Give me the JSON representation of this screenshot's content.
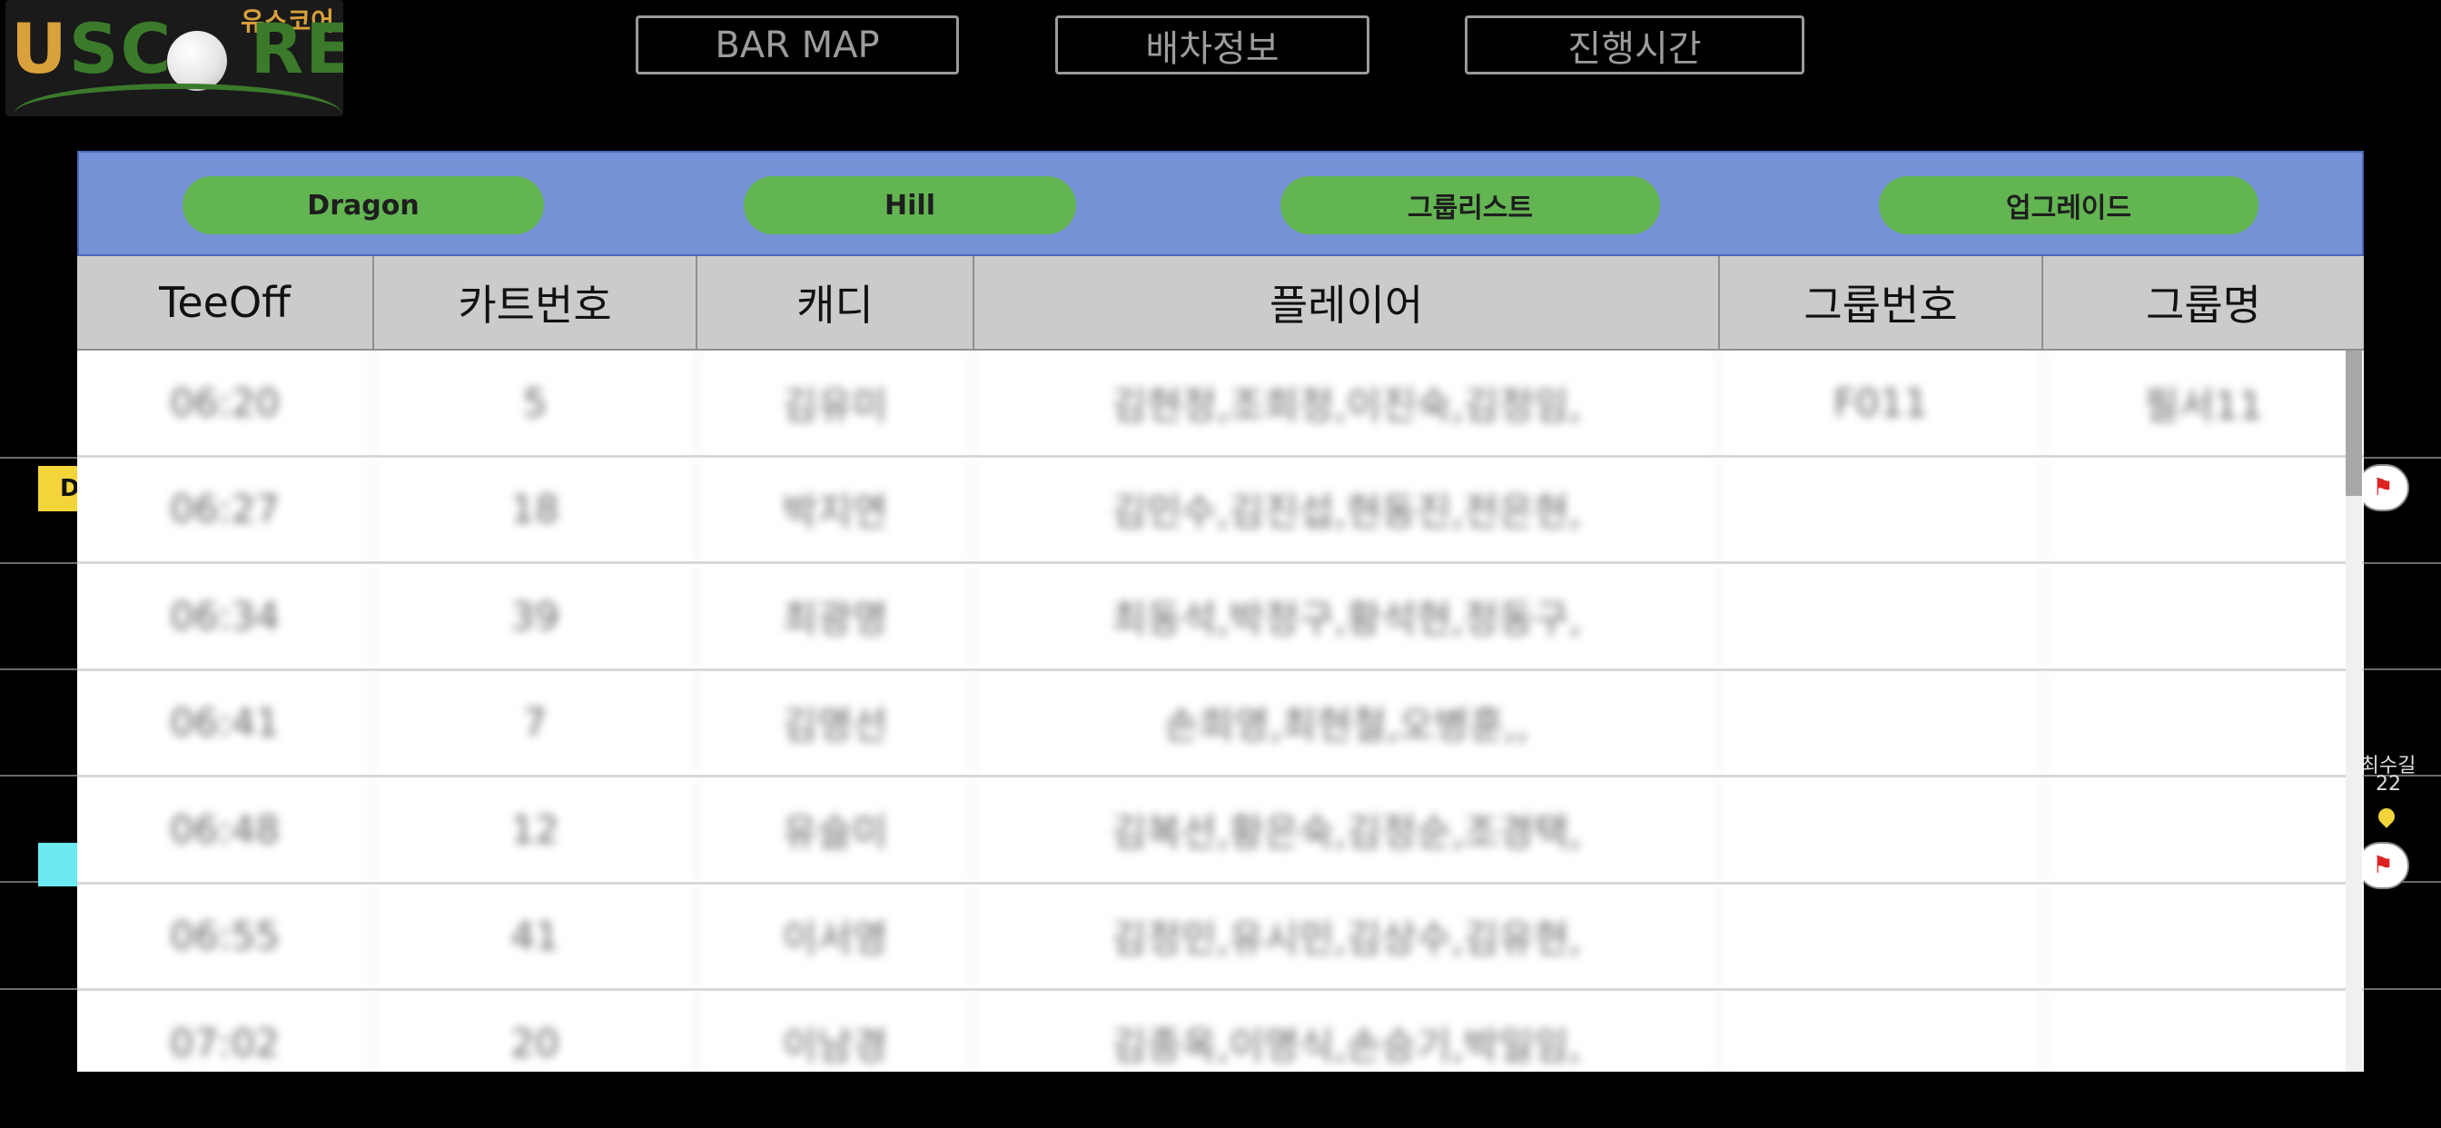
{
  "logo": {
    "small_text": "유스코어",
    "big_text": "USCORE"
  },
  "top_buttons": [
    "BAR MAP",
    "배차정보",
    "진행시간"
  ],
  "tabs": [
    "Dragon",
    "Hill",
    "그룹리스트",
    "업그레이드"
  ],
  "side_labels": {
    "yellow": "D",
    "right": "최수길 22"
  },
  "table": {
    "headers": [
      "TeeOff",
      "카트번호",
      "캐디",
      "플레이어",
      "그룹번호",
      "그룹명"
    ],
    "rows": [
      [
        "06:20",
        "5",
        "김유미",
        "김현정,조희정,이진숙,김정임,",
        "F011",
        "필서11"
      ],
      [
        "06:27",
        "18",
        "박지연",
        "김민수,김진섭,현동진,전은현,",
        "",
        ""
      ],
      [
        "06:34",
        "39",
        "최광명",
        "최동석,박정구,황석현,정동구,",
        "",
        ""
      ],
      [
        "06:41",
        "7",
        "김명선",
        "손희영,최현철,오병훈,,",
        "",
        ""
      ],
      [
        "06:48",
        "12",
        "유슬미",
        "김복선,황은숙,김정순,조경택,",
        "",
        ""
      ],
      [
        "06:55",
        "41",
        "이서영",
        "김정민,유시민,김상수,김유현,",
        "",
        ""
      ],
      [
        "07:02",
        "20",
        "이남경",
        "김종옥,이명식,손승기,박일임,",
        "",
        ""
      ]
    ]
  },
  "colors": {
    "tab_bar": "#7692d6",
    "tab_pill": "#63b552",
    "header_bg": "#cbcbcb",
    "logo_gold": "#d9a13b",
    "logo_green": "#3b7a2a"
  }
}
